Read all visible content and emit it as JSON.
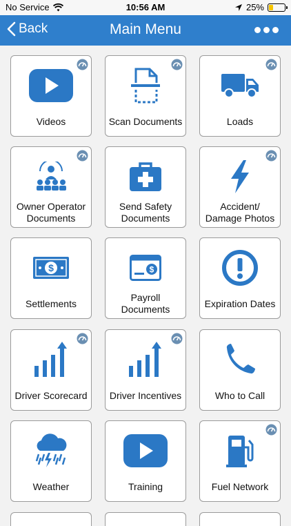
{
  "status_bar": {
    "carrier": "No Service",
    "time": "10:56 AM",
    "battery": "25%",
    "battery_level": 0.25
  },
  "nav": {
    "back_label": "Back",
    "title": "Main Menu"
  },
  "tiles": [
    {
      "label": "Videos",
      "icon": "video-play-icon"
    },
    {
      "label": "Scan Documents",
      "icon": "scan-document-icon"
    },
    {
      "label": "Loads",
      "icon": "truck-icon"
    },
    {
      "label": "Owner Operator Documents",
      "icon": "people-presentation-icon"
    },
    {
      "label": "Send Safety Documents",
      "icon": "first-aid-kit-icon"
    },
    {
      "label": "Accident/ Damage Photos",
      "icon": "lightning-bolt-icon"
    },
    {
      "label": "Settlements",
      "icon": "dollar-bill-icon"
    },
    {
      "label": "Payroll Documents",
      "icon": "payroll-check-icon"
    },
    {
      "label": "Expiration Dates",
      "icon": "exclamation-circle-icon"
    },
    {
      "label": "Driver Scorecard",
      "icon": "bar-chart-arrow-icon"
    },
    {
      "label": "Driver Incentives",
      "icon": "bar-chart-arrow-icon"
    },
    {
      "label": "Who to Call",
      "icon": "phone-icon"
    },
    {
      "label": "Weather",
      "icon": "storm-cloud-icon"
    },
    {
      "label": "Training",
      "icon": "video-play-icon"
    },
    {
      "label": "Fuel Network",
      "icon": "fuel-pump-icon"
    }
  ],
  "colors": {
    "accent": "#2f7fcc",
    "icon": "#2b78c5"
  }
}
